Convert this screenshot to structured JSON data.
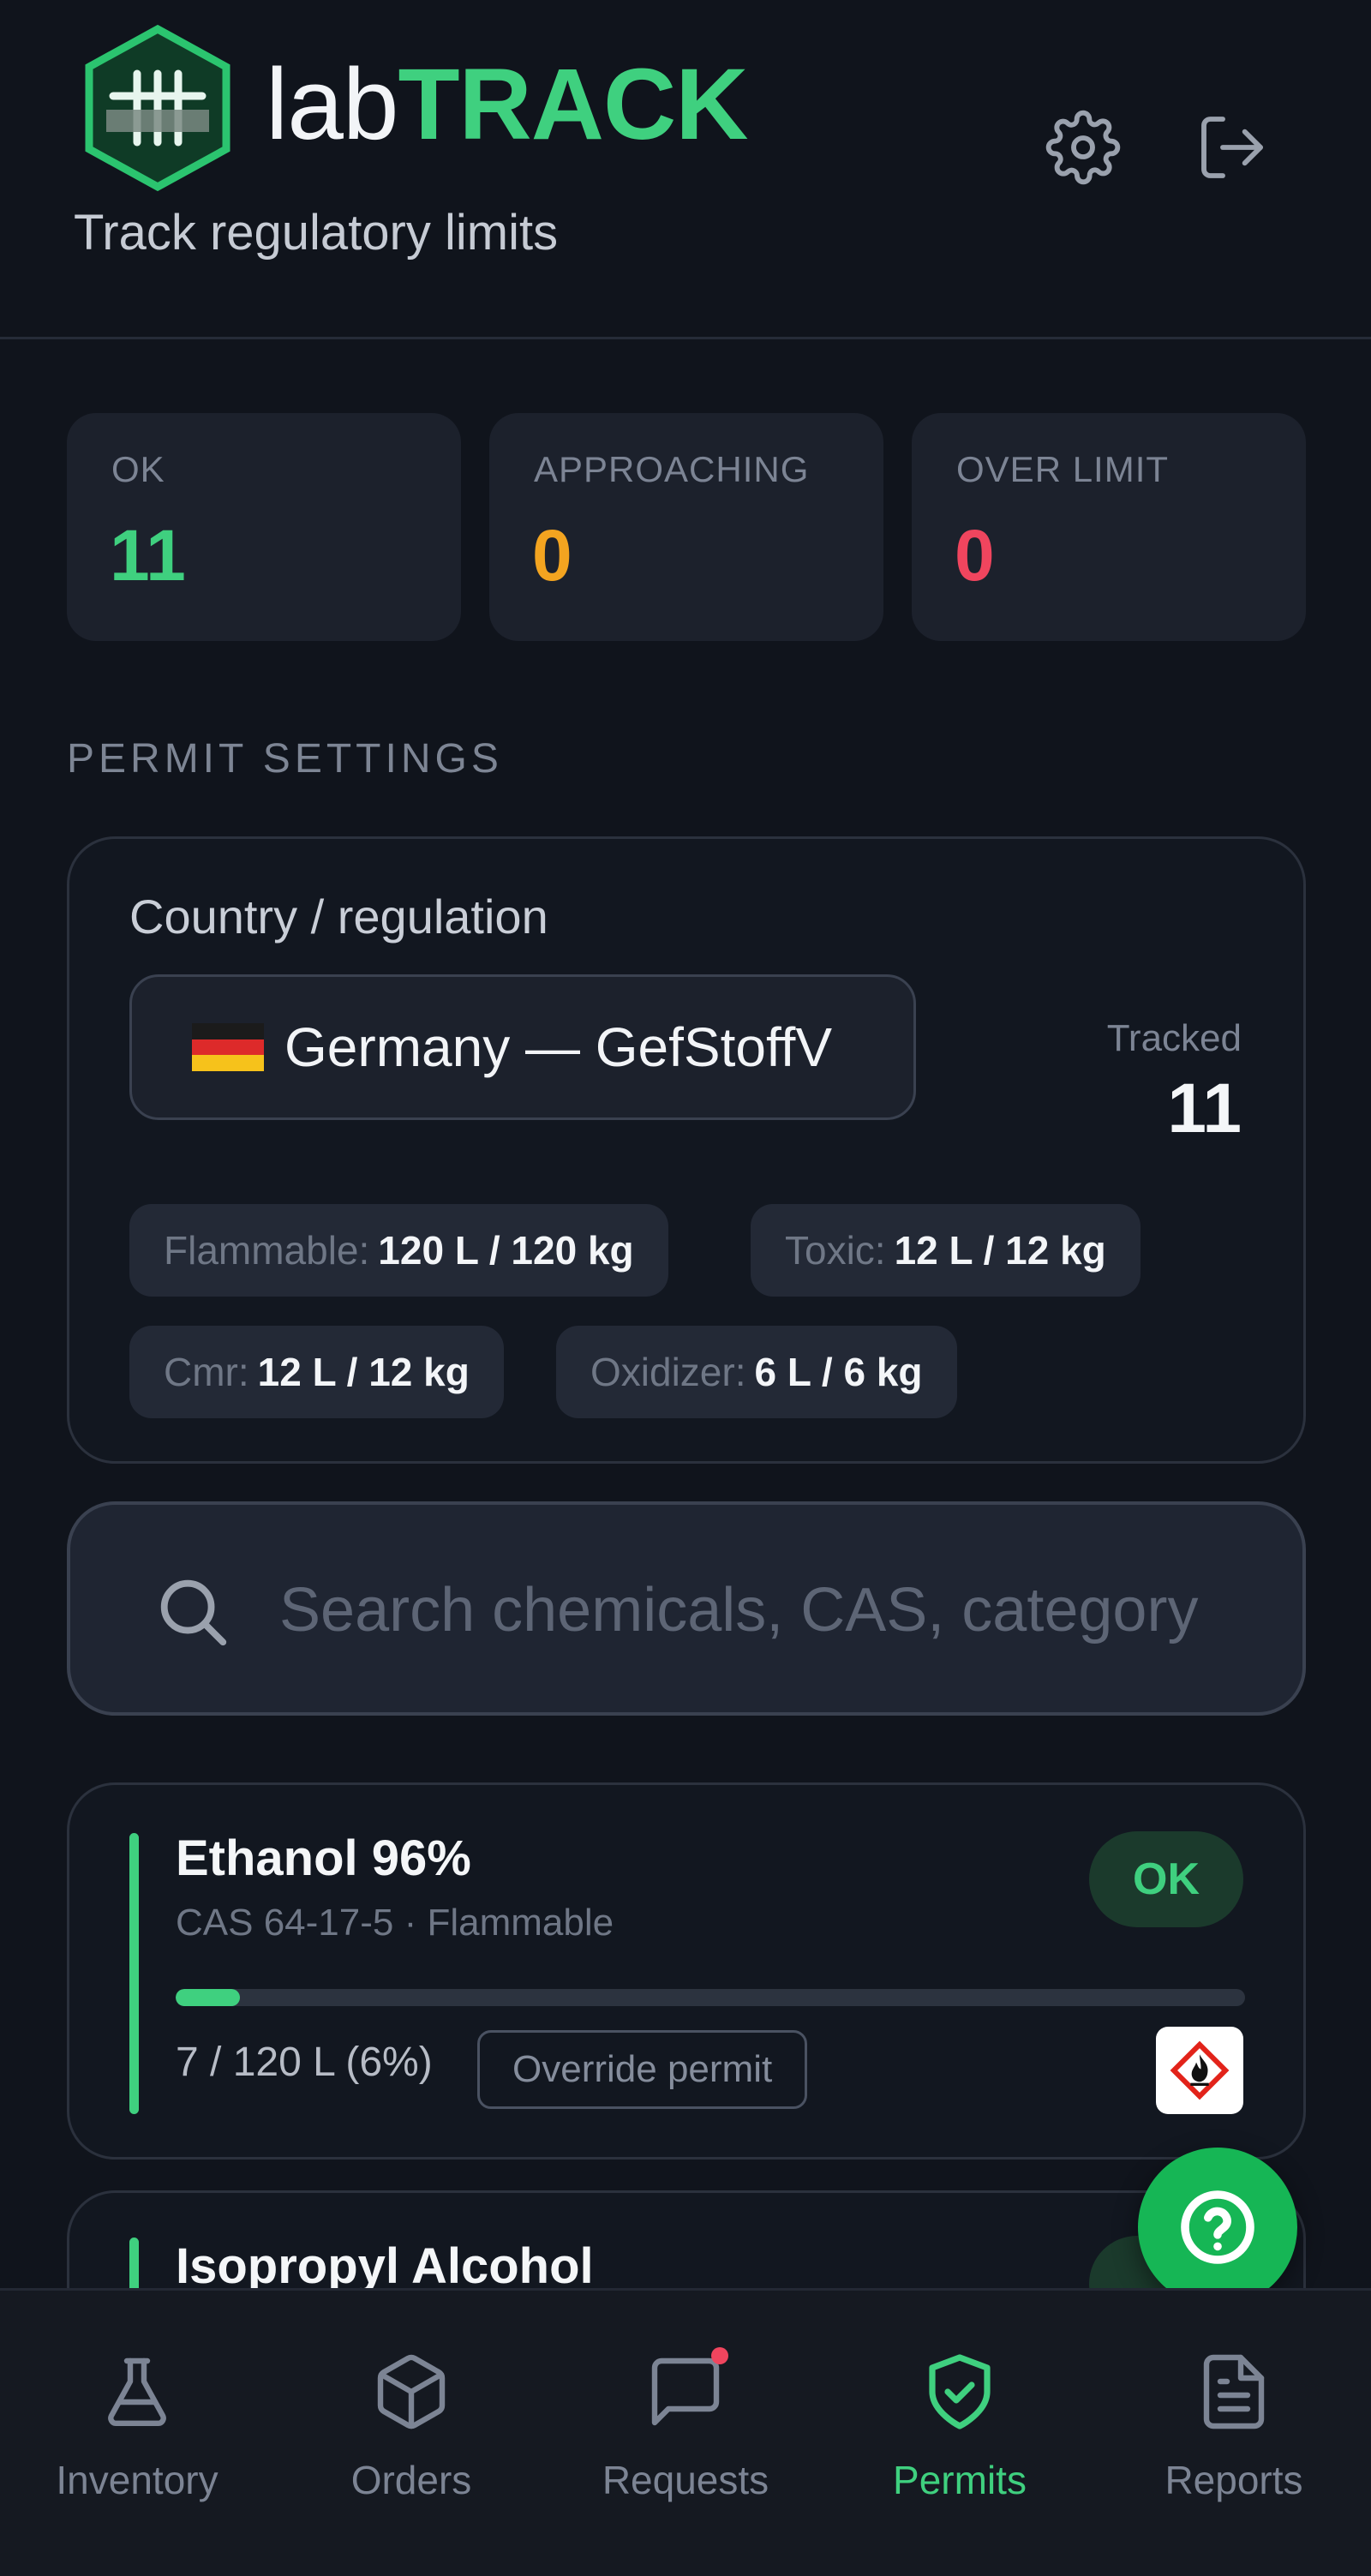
{
  "app": {
    "brand_prefix": "lab",
    "brand_suffix": "TRACK",
    "tagline": "Track regulatory limits"
  },
  "colors": {
    "accent": "#3fd07f",
    "ok": "#3fd07f",
    "approaching": "#f3a420",
    "over_limit": "#f0455e",
    "background": "#10141c",
    "card": "#1c212c"
  },
  "header_icons": [
    "gear-icon",
    "logout-icon"
  ],
  "stats": [
    {
      "label": "OK",
      "value": "11",
      "color": "#3fd07f"
    },
    {
      "label": "APPROACHING",
      "value": "0",
      "color": "#f3a420"
    },
    {
      "label": "OVER LIMIT",
      "value": "0",
      "color": "#f0455e"
    }
  ],
  "permit_settings": {
    "section_title": "PERMIT SETTINGS",
    "country_label": "Country / regulation",
    "country_value": "Germany — GefStoffV",
    "tracked_label": "Tracked",
    "tracked_value": "11",
    "limits": [
      {
        "key": "Flammable:",
        "value": "120 L / 120 kg"
      },
      {
        "key": "Toxic:",
        "value": "12 L / 12 kg"
      },
      {
        "key": "Cmr:",
        "value": "12 L / 12 kg"
      },
      {
        "key": "Oxidizer:",
        "value": "6 L / 6 kg"
      }
    ]
  },
  "search": {
    "placeholder": "Search chemicals, CAS, category",
    "value": ""
  },
  "chemicals": [
    {
      "name": "Ethanol 96%",
      "cas": "CAS 64-17-5",
      "category": "· Flammable",
      "status": "OK",
      "usage_text": "7 / 120 L (6%)",
      "usage_fraction": 0.06,
      "override_label": "Override permit",
      "hazard_icon": "ghs-flame-icon"
    },
    {
      "name": "Isopropyl Alcohol"
    }
  ],
  "help_button_icon": "help-icon",
  "nav": [
    {
      "label": "Inventory",
      "icon": "flask-icon",
      "active": false
    },
    {
      "label": "Orders",
      "icon": "box-icon",
      "active": false
    },
    {
      "label": "Requests",
      "icon": "chat-icon",
      "active": false,
      "notification": true
    },
    {
      "label": "Permits",
      "icon": "shield-check-icon",
      "active": true
    },
    {
      "label": "Reports",
      "icon": "document-icon",
      "active": false
    }
  ]
}
